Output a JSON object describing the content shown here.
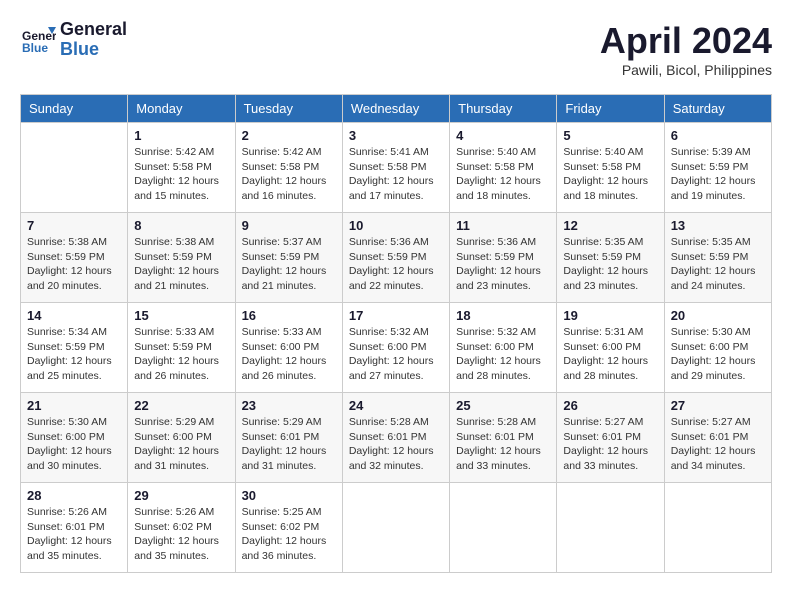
{
  "header": {
    "logo_line1": "General",
    "logo_line2": "Blue",
    "month_title": "April 2024",
    "location": "Pawili, Bicol, Philippines"
  },
  "weekdays": [
    "Sunday",
    "Monday",
    "Tuesday",
    "Wednesday",
    "Thursday",
    "Friday",
    "Saturday"
  ],
  "weeks": [
    [
      {
        "day": "",
        "sunrise": "",
        "sunset": "",
        "daylight": ""
      },
      {
        "day": "1",
        "sunrise": "Sunrise: 5:42 AM",
        "sunset": "Sunset: 5:58 PM",
        "daylight": "Daylight: 12 hours and 15 minutes."
      },
      {
        "day": "2",
        "sunrise": "Sunrise: 5:42 AM",
        "sunset": "Sunset: 5:58 PM",
        "daylight": "Daylight: 12 hours and 16 minutes."
      },
      {
        "day": "3",
        "sunrise": "Sunrise: 5:41 AM",
        "sunset": "Sunset: 5:58 PM",
        "daylight": "Daylight: 12 hours and 17 minutes."
      },
      {
        "day": "4",
        "sunrise": "Sunrise: 5:40 AM",
        "sunset": "Sunset: 5:58 PM",
        "daylight": "Daylight: 12 hours and 18 minutes."
      },
      {
        "day": "5",
        "sunrise": "Sunrise: 5:40 AM",
        "sunset": "Sunset: 5:58 PM",
        "daylight": "Daylight: 12 hours and 18 minutes."
      },
      {
        "day": "6",
        "sunrise": "Sunrise: 5:39 AM",
        "sunset": "Sunset: 5:59 PM",
        "daylight": "Daylight: 12 hours and 19 minutes."
      }
    ],
    [
      {
        "day": "7",
        "sunrise": "Sunrise: 5:38 AM",
        "sunset": "Sunset: 5:59 PM",
        "daylight": "Daylight: 12 hours and 20 minutes."
      },
      {
        "day": "8",
        "sunrise": "Sunrise: 5:38 AM",
        "sunset": "Sunset: 5:59 PM",
        "daylight": "Daylight: 12 hours and 21 minutes."
      },
      {
        "day": "9",
        "sunrise": "Sunrise: 5:37 AM",
        "sunset": "Sunset: 5:59 PM",
        "daylight": "Daylight: 12 hours and 21 minutes."
      },
      {
        "day": "10",
        "sunrise": "Sunrise: 5:36 AM",
        "sunset": "Sunset: 5:59 PM",
        "daylight": "Daylight: 12 hours and 22 minutes."
      },
      {
        "day": "11",
        "sunrise": "Sunrise: 5:36 AM",
        "sunset": "Sunset: 5:59 PM",
        "daylight": "Daylight: 12 hours and 23 minutes."
      },
      {
        "day": "12",
        "sunrise": "Sunrise: 5:35 AM",
        "sunset": "Sunset: 5:59 PM",
        "daylight": "Daylight: 12 hours and 23 minutes."
      },
      {
        "day": "13",
        "sunrise": "Sunrise: 5:35 AM",
        "sunset": "Sunset: 5:59 PM",
        "daylight": "Daylight: 12 hours and 24 minutes."
      }
    ],
    [
      {
        "day": "14",
        "sunrise": "Sunrise: 5:34 AM",
        "sunset": "Sunset: 5:59 PM",
        "daylight": "Daylight: 12 hours and 25 minutes."
      },
      {
        "day": "15",
        "sunrise": "Sunrise: 5:33 AM",
        "sunset": "Sunset: 5:59 PM",
        "daylight": "Daylight: 12 hours and 26 minutes."
      },
      {
        "day": "16",
        "sunrise": "Sunrise: 5:33 AM",
        "sunset": "Sunset: 6:00 PM",
        "daylight": "Daylight: 12 hours and 26 minutes."
      },
      {
        "day": "17",
        "sunrise": "Sunrise: 5:32 AM",
        "sunset": "Sunset: 6:00 PM",
        "daylight": "Daylight: 12 hours and 27 minutes."
      },
      {
        "day": "18",
        "sunrise": "Sunrise: 5:32 AM",
        "sunset": "Sunset: 6:00 PM",
        "daylight": "Daylight: 12 hours and 28 minutes."
      },
      {
        "day": "19",
        "sunrise": "Sunrise: 5:31 AM",
        "sunset": "Sunset: 6:00 PM",
        "daylight": "Daylight: 12 hours and 28 minutes."
      },
      {
        "day": "20",
        "sunrise": "Sunrise: 5:30 AM",
        "sunset": "Sunset: 6:00 PM",
        "daylight": "Daylight: 12 hours and 29 minutes."
      }
    ],
    [
      {
        "day": "21",
        "sunrise": "Sunrise: 5:30 AM",
        "sunset": "Sunset: 6:00 PM",
        "daylight": "Daylight: 12 hours and 30 minutes."
      },
      {
        "day": "22",
        "sunrise": "Sunrise: 5:29 AM",
        "sunset": "Sunset: 6:00 PM",
        "daylight": "Daylight: 12 hours and 31 minutes."
      },
      {
        "day": "23",
        "sunrise": "Sunrise: 5:29 AM",
        "sunset": "Sunset: 6:01 PM",
        "daylight": "Daylight: 12 hours and 31 minutes."
      },
      {
        "day": "24",
        "sunrise": "Sunrise: 5:28 AM",
        "sunset": "Sunset: 6:01 PM",
        "daylight": "Daylight: 12 hours and 32 minutes."
      },
      {
        "day": "25",
        "sunrise": "Sunrise: 5:28 AM",
        "sunset": "Sunset: 6:01 PM",
        "daylight": "Daylight: 12 hours and 33 minutes."
      },
      {
        "day": "26",
        "sunrise": "Sunrise: 5:27 AM",
        "sunset": "Sunset: 6:01 PM",
        "daylight": "Daylight: 12 hours and 33 minutes."
      },
      {
        "day": "27",
        "sunrise": "Sunrise: 5:27 AM",
        "sunset": "Sunset: 6:01 PM",
        "daylight": "Daylight: 12 hours and 34 minutes."
      }
    ],
    [
      {
        "day": "28",
        "sunrise": "Sunrise: 5:26 AM",
        "sunset": "Sunset: 6:01 PM",
        "daylight": "Daylight: 12 hours and 35 minutes."
      },
      {
        "day": "29",
        "sunrise": "Sunrise: 5:26 AM",
        "sunset": "Sunset: 6:02 PM",
        "daylight": "Daylight: 12 hours and 35 minutes."
      },
      {
        "day": "30",
        "sunrise": "Sunrise: 5:25 AM",
        "sunset": "Sunset: 6:02 PM",
        "daylight": "Daylight: 12 hours and 36 minutes."
      },
      {
        "day": "",
        "sunrise": "",
        "sunset": "",
        "daylight": ""
      },
      {
        "day": "",
        "sunrise": "",
        "sunset": "",
        "daylight": ""
      },
      {
        "day": "",
        "sunrise": "",
        "sunset": "",
        "daylight": ""
      },
      {
        "day": "",
        "sunrise": "",
        "sunset": "",
        "daylight": ""
      }
    ]
  ]
}
